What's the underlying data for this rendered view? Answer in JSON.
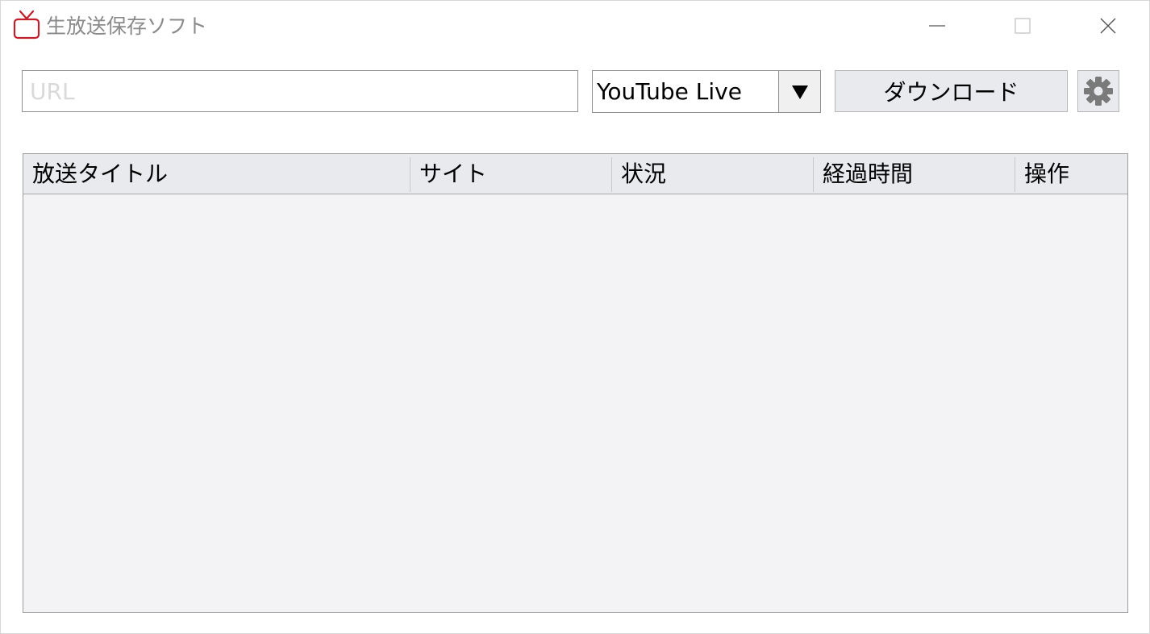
{
  "window": {
    "title": "生放送保存ソフト",
    "accent_color": "#c0202b"
  },
  "toolbar": {
    "url_placeholder": "URL",
    "url_value": "",
    "site_select_value": "YouTube Live",
    "download_label": "ダウンロード",
    "settings_icon": "gear-icon"
  },
  "table": {
    "columns": [
      "放送タイトル",
      "サイト",
      "状況",
      "経過時間",
      "操作"
    ],
    "rows": []
  }
}
